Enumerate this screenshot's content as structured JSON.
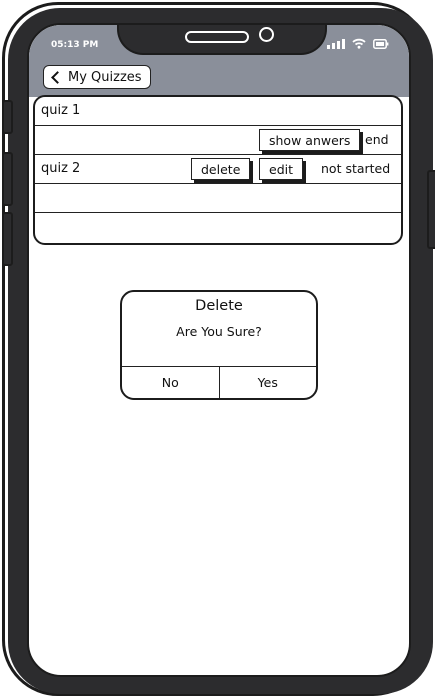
{
  "status_bar": {
    "time": "05:13 PM"
  },
  "nav": {
    "back_label": "My Quizzes"
  },
  "quizzes": [
    {
      "name": "quiz 1"
    },
    {
      "action": "show anwers",
      "status": "end"
    },
    {
      "name": "quiz 2",
      "delete_label": "delete",
      "edit_label": "edit",
      "status": "not started"
    }
  ],
  "dialog": {
    "title": "Delete",
    "message": "Are You Sure?",
    "no_label": "No",
    "yes_label": "Yes"
  }
}
